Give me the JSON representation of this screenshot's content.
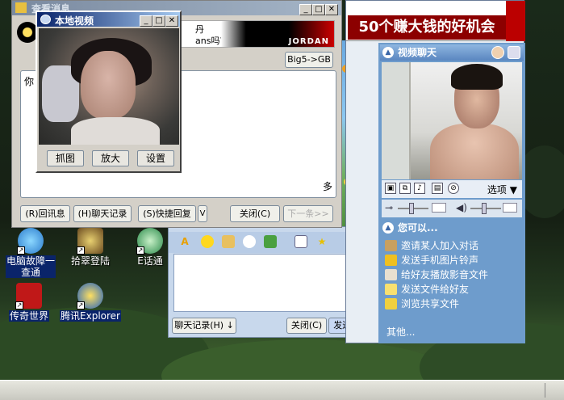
{
  "desktop": {
    "icons": [
      {
        "label": "电脑故障一\n查通",
        "line1": "电脑故障一",
        "line2": "查通"
      },
      {
        "label": "拾翠登陆"
      },
      {
        "label": "E话通"
      },
      {
        "label": "传奇世界"
      },
      {
        "label": "腾讯Explorer"
      }
    ]
  },
  "chat_window": {
    "title": "查看消息",
    "banner_text": "丹",
    "banner_text2": "ans吗?",
    "banner_brand": "JORDAN",
    "encoding_button": "Big5->GB",
    "message_start": "你",
    "message_tail": "多",
    "buttons": {
      "reply": "(R)回讯息",
      "history": "(H)聊天记录",
      "quick_reply": "(S)快捷回复",
      "quick_reply_arrow": "V",
      "close": "关闭(C)",
      "next": "下一条>>"
    }
  },
  "video_popup": {
    "title": "本地视频",
    "buttons": {
      "capture": "抓图",
      "zoom": "放大",
      "settings": "设置"
    }
  },
  "qq_dialog": {
    "history_button": "聊天记录(H)",
    "close_button": "关闭(C)",
    "send_button": "发送(S)"
  },
  "right_panel": {
    "ad_text": "50个赚大钱的好机会",
    "video_chat_title": "视频聊天",
    "options_label": "选项",
    "you_can_title": "您可以...",
    "actions": [
      "邀请某人加入对话",
      "发送手机图片铃声",
      "给好友播放影音文件",
      "发送文件给好友",
      "浏览共享文件"
    ],
    "more_label": "其他..."
  }
}
